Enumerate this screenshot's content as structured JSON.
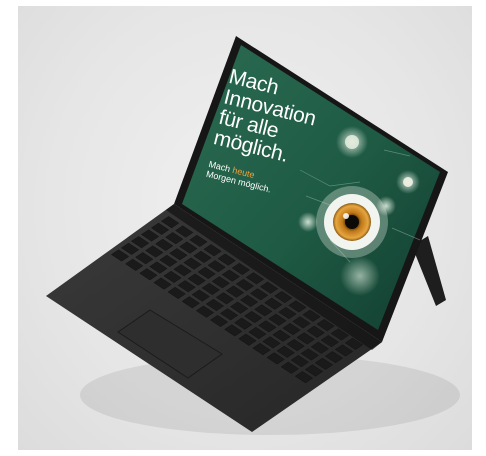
{
  "screen": {
    "headline_line1": "Mach",
    "headline_accent": "Innovation",
    "headline_line3": "für alle",
    "headline_line4": "möglich.",
    "tagline_prefix": "Mach ",
    "tagline_accent": "heute",
    "tagline_line2": "Morgen möglich.",
    "accent_color": "#f2a23a",
    "background_color": "#1f5a45"
  }
}
